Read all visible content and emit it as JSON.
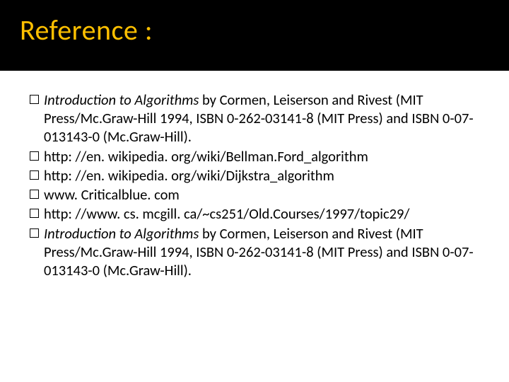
{
  "title": "Reference :",
  "items": [
    {
      "italicPart": "Introduction to Algorithms",
      "rest": " by Cormen, Leiserson and Rivest (MIT Press/Mc.Graw-Hill 1994, ISBN 0-262-03141-8 (MIT Press) and ISBN 0-07-013143-0 (Mc.Graw-Hill)."
    },
    {
      "italicPart": "",
      "rest": "http: //en. wikipedia. org/wiki/Bellman.Ford_algorithm"
    },
    {
      "italicPart": "",
      "rest": "http: //en. wikipedia. org/wiki/Dijkstra_algorithm"
    },
    {
      "italicPart": "",
      "rest": "www. Criticalblue. com"
    },
    {
      "italicPart": "",
      "rest": "http: //www. cs. mcgill. ca/~cs251/Old.Courses/1997/topic29/"
    },
    {
      "italicPart": "Introduction to Algorithms",
      "rest": " by Cormen, Leiserson and Rivest (MIT Press/Mc.Graw-Hill 1994, ISBN 0-262-03141-8 (MIT Press) and ISBN 0-07-013143-0 (Mc.Graw-Hill)."
    }
  ]
}
